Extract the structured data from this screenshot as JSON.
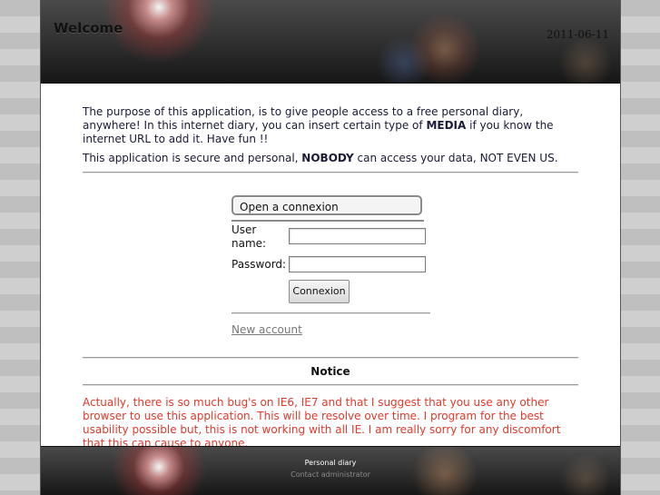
{
  "header": {
    "title": "Welcome",
    "date": "2011-06-11"
  },
  "intro": {
    "paragraph1_part1": "The purpose of this application, is to give people access to a free personal diary, anywhere! In this internet diary, you can insert certain type of ",
    "paragraph1_bold": "MEDIA",
    "paragraph1_part2": " if you know the internet URL to add it. Have fun !!",
    "paragraph2_part1": "This application is secure and personal, ",
    "paragraph2_bold": "NOBODY",
    "paragraph2_part2": " can access your data, NOT EVEN US."
  },
  "login": {
    "tab_label": "Open a connexion",
    "username_label": "User name:",
    "username_value": "",
    "password_label": "Password:",
    "password_value": "",
    "submit_label": "Connexion",
    "new_account_link": "New account"
  },
  "notice": {
    "title": "Notice",
    "text": "Actually, there is so much bug's on IE6, IE7 and that I suggest that you use any other browser to use this application. This will be resolve over time. I program for the best usability possible but, this is not working with all IE. I am really sorry for any discomfort that this can cause to anyone."
  },
  "footer": {
    "title": "Personal diary",
    "contact_link": "Contact administrator"
  },
  "colors": {
    "notice_text": "#e03a2a",
    "body_text": "#1a1a3a",
    "link": "#777777"
  }
}
